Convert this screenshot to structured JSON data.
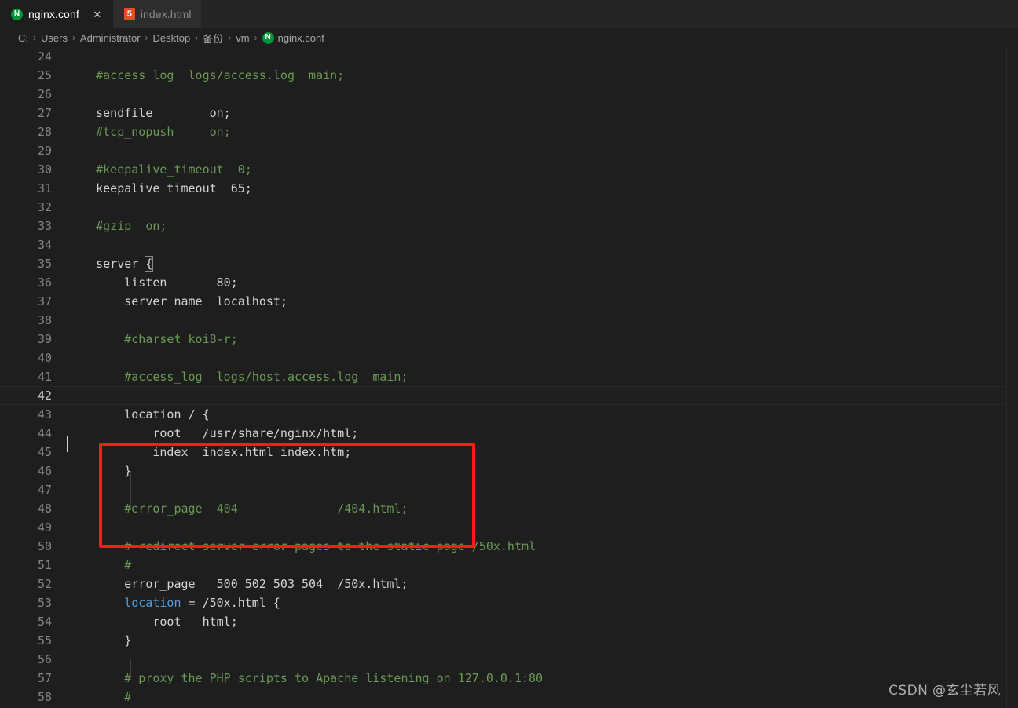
{
  "window": {
    "theme_background": "#1e1e1e",
    "accent_red": "#ff1a1a"
  },
  "tabbar": {
    "tabs": [
      {
        "label": "nginx.conf",
        "icon": "nginx-icon",
        "icon_glyph": "N",
        "active": true,
        "close_glyph": "✕"
      },
      {
        "label": "index.html",
        "icon": "html5-icon",
        "icon_glyph": "5",
        "active": false,
        "close_glyph": ""
      }
    ]
  },
  "breadcrumb": {
    "separator": "›",
    "items": [
      {
        "label": "C:"
      },
      {
        "label": "Users"
      },
      {
        "label": "Administrator"
      },
      {
        "label": "Desktop"
      },
      {
        "label": "备份"
      },
      {
        "label": "vm"
      },
      {
        "label": "nginx.conf",
        "icon": "nginx-icon",
        "icon_glyph": "N"
      }
    ]
  },
  "editor": {
    "first_line_number": 24,
    "current_line": 42,
    "cursor_line": 42,
    "lines": [
      {
        "n": 24,
        "tokens": []
      },
      {
        "n": 25,
        "tokens": [
          {
            "t": "    #access_log  logs/access.log  main;",
            "c": "comment"
          }
        ]
      },
      {
        "n": 26,
        "tokens": []
      },
      {
        "n": 27,
        "tokens": [
          {
            "t": "    sendfile        on;",
            "c": "plain"
          }
        ]
      },
      {
        "n": 28,
        "tokens": [
          {
            "t": "    #tcp_nopush     on;",
            "c": "comment"
          }
        ]
      },
      {
        "n": 29,
        "tokens": []
      },
      {
        "n": 30,
        "tokens": [
          {
            "t": "    #keepalive_timeout  0;",
            "c": "comment"
          }
        ]
      },
      {
        "n": 31,
        "tokens": [
          {
            "t": "    keepalive_timeout  65;",
            "c": "plain"
          }
        ]
      },
      {
        "n": 32,
        "tokens": []
      },
      {
        "n": 33,
        "tokens": [
          {
            "t": "    #gzip  on;",
            "c": "comment"
          }
        ]
      },
      {
        "n": 34,
        "tokens": []
      },
      {
        "n": 35,
        "tokens": [
          {
            "t": "    server ",
            "c": "plain"
          },
          {
            "t": "{",
            "c": "bracket"
          }
        ]
      },
      {
        "n": 36,
        "tokens": [
          {
            "t": "        listen       80;",
            "c": "plain"
          }
        ]
      },
      {
        "n": 37,
        "tokens": [
          {
            "t": "        server_name  localhost;",
            "c": "plain"
          }
        ]
      },
      {
        "n": 38,
        "tokens": []
      },
      {
        "n": 39,
        "tokens": [
          {
            "t": "        #charset koi8-r;",
            "c": "comment"
          }
        ]
      },
      {
        "n": 40,
        "tokens": []
      },
      {
        "n": 41,
        "tokens": [
          {
            "t": "        #access_log  logs/host.access.log  main;",
            "c": "comment"
          }
        ]
      },
      {
        "n": 42,
        "tokens": []
      },
      {
        "n": 43,
        "tokens": [
          {
            "t": "        location / {",
            "c": "plain"
          }
        ]
      },
      {
        "n": 44,
        "tokens": [
          {
            "t": "            root   /usr/share/nginx/html;",
            "c": "plain"
          }
        ]
      },
      {
        "n": 45,
        "tokens": [
          {
            "t": "            index  index.html index.htm;",
            "c": "plain"
          }
        ]
      },
      {
        "n": 46,
        "tokens": [
          {
            "t": "        }",
            "c": "plain"
          }
        ]
      },
      {
        "n": 47,
        "tokens": []
      },
      {
        "n": 48,
        "tokens": [
          {
            "t": "        #error_page  404              /404.html;",
            "c": "comment"
          }
        ]
      },
      {
        "n": 49,
        "tokens": []
      },
      {
        "n": 50,
        "tokens": [
          {
            "t": "        # redirect server error pages to the static page /50x.html",
            "c": "comment"
          }
        ]
      },
      {
        "n": 51,
        "tokens": [
          {
            "t": "        #",
            "c": "comment"
          }
        ]
      },
      {
        "n": 52,
        "tokens": [
          {
            "t": "        error_page   500 502 503 504  /50x.html;",
            "c": "plain"
          }
        ]
      },
      {
        "n": 53,
        "tokens": [
          {
            "t": "        ",
            "c": "plain"
          },
          {
            "t": "location",
            "c": "key"
          },
          {
            "t": " = /50x.html {",
            "c": "plain"
          }
        ]
      },
      {
        "n": 54,
        "tokens": [
          {
            "t": "            root   html;",
            "c": "plain"
          }
        ]
      },
      {
        "n": 55,
        "tokens": [
          {
            "t": "        }",
            "c": "plain"
          }
        ]
      },
      {
        "n": 56,
        "tokens": []
      },
      {
        "n": 57,
        "tokens": [
          {
            "t": "        # proxy the PHP scripts to Apache listening on 127.0.0.1:80",
            "c": "comment"
          }
        ]
      },
      {
        "n": 58,
        "tokens": [
          {
            "t": "        #",
            "c": "comment"
          }
        ]
      }
    ],
    "annotation_box": {
      "label": "location-block-highlight",
      "covers_lines": "42-47",
      "color": "#ff1a1a"
    }
  },
  "watermark": {
    "text": "CSDN @玄尘若风"
  }
}
